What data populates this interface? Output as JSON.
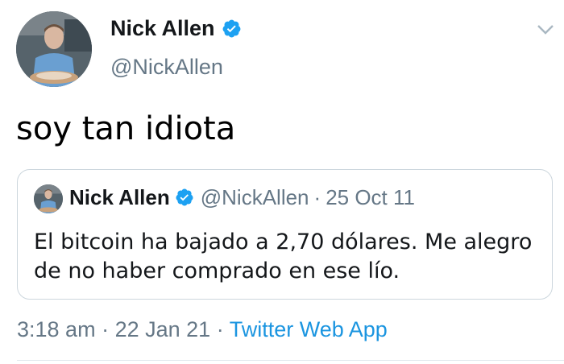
{
  "tweet": {
    "author": {
      "name": "Nick Allen",
      "handle": "@NickAllen",
      "verified": true
    },
    "text": "soy tan idiota",
    "quoted": {
      "author": {
        "name": "Nick Allen",
        "handle": "@NickAllen",
        "verified": true
      },
      "date": "25 Oct 11",
      "text": "El bitcoin ha bajado a 2,70 dólares. Me alegro de no haber comprado en ese lío."
    },
    "timestamp": {
      "time": "3:18 am",
      "date": "22 Jan 21",
      "separator": "·",
      "source": "Twitter Web App"
    }
  },
  "colors": {
    "text_primary": "#14171a",
    "text_secondary": "#657786",
    "link": "#1b95e0",
    "verified": "#1da1f2",
    "border": "#ccd6dd"
  },
  "icons": {
    "verified": "verified-badge-icon",
    "menu": "chevron-down-icon"
  }
}
